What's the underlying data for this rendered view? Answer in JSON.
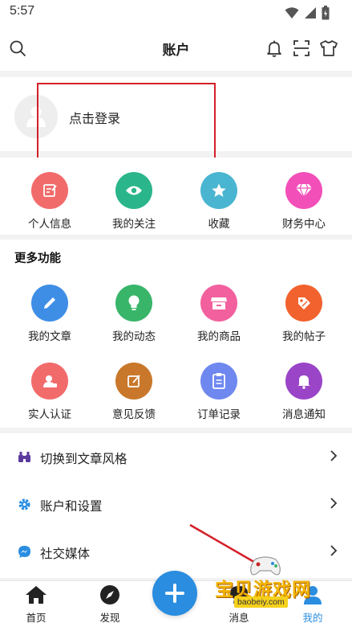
{
  "status_bar": {
    "time": "5:57"
  },
  "header": {
    "title": "账户"
  },
  "login": {
    "label": "点击登录"
  },
  "quick_actions": [
    {
      "label": "个人信息",
      "icon": "edit-icon",
      "color": "#f26b6b"
    },
    {
      "label": "我的关注",
      "icon": "eye-icon",
      "color": "#2bb58a"
    },
    {
      "label": "收藏",
      "icon": "star-icon",
      "color": "#4ab5d1"
    },
    {
      "label": "财务中心",
      "icon": "diamond-icon",
      "color": "#f24fb8"
    }
  ],
  "more": {
    "title": "更多功能",
    "items": [
      {
        "label": "我的文章",
        "icon": "pen-icon",
        "color": "#3e8ee6"
      },
      {
        "label": "我的动态",
        "icon": "lightbulb-icon",
        "color": "#39b56a"
      },
      {
        "label": "我的商品",
        "icon": "store-icon",
        "color": "#f2609e"
      },
      {
        "label": "我的帖子",
        "icon": "tag-icon",
        "color": "#f2622e"
      },
      {
        "label": "实人认证",
        "icon": "id-card-icon",
        "color": "#f26b6b"
      },
      {
        "label": "意见反馈",
        "icon": "feedback-icon",
        "color": "#c9782b"
      },
      {
        "label": "订单记录",
        "icon": "clipboard-icon",
        "color": "#6f88f0"
      },
      {
        "label": "消息通知",
        "icon": "bell-icon",
        "color": "#9a45c7"
      }
    ]
  },
  "list": [
    {
      "label": "切换到文章风格",
      "icon": "binoculars-icon",
      "color": "#5b3a9e"
    },
    {
      "label": "账户和设置",
      "icon": "gear-icon",
      "color": "#2a8de0"
    },
    {
      "label": "社交媒体",
      "icon": "messenger-icon",
      "color": "#2a8de0"
    }
  ],
  "tabs": [
    {
      "label": "首页",
      "icon": "home-icon"
    },
    {
      "label": "发现",
      "icon": "compass-icon"
    },
    {
      "label": "消息",
      "icon": "chat-icon"
    },
    {
      "label": "我的",
      "icon": "user-icon"
    }
  ],
  "watermark": {
    "title": "宝贝游戏网",
    "url": "baobeiy.com"
  },
  "colors": {
    "accent": "#2a8de0",
    "annotation": "#d4202a"
  }
}
